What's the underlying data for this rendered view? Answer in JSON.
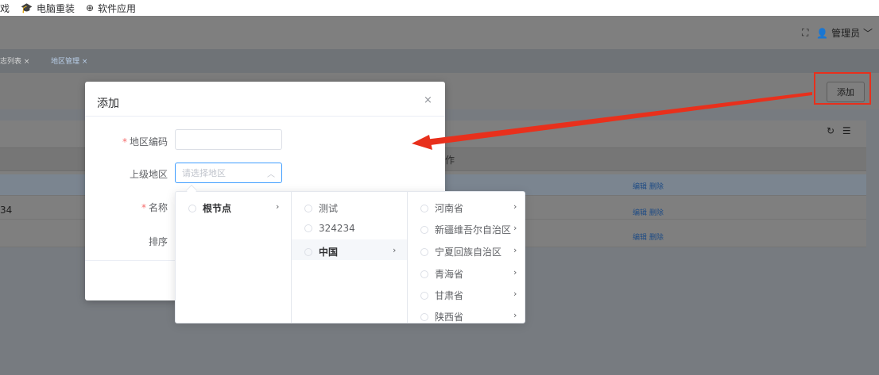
{
  "bookmarks": [
    {
      "label": "戏",
      "icon": ""
    },
    {
      "label": "电脑重装",
      "icon": "graduation-cap-icon"
    },
    {
      "label": "软件应用",
      "icon": "globe-icon"
    }
  ],
  "header": {
    "user": "管理员"
  },
  "tabs": [
    {
      "label": "志列表 ×"
    },
    {
      "label": "地区管理 ×"
    }
  ],
  "toolbar": {
    "add_label": "添加"
  },
  "table": {
    "op_header": "作",
    "rows": [
      {
        "cell": "",
        "ops": "编辑 删除"
      },
      {
        "cell": "34",
        "ops": "编辑 删除"
      },
      {
        "cell": "",
        "ops": "编辑 删除"
      }
    ]
  },
  "dialog": {
    "title": "添加",
    "close": "×",
    "fields": {
      "code_label": "地区编码",
      "parent_label": "上级地区",
      "parent_placeholder": "请选择地区",
      "name_label": "名称",
      "order_label": "排序"
    }
  },
  "cascader": {
    "col1": [
      {
        "label": "根节点",
        "has_children": true
      }
    ],
    "col2": [
      {
        "label": "测试",
        "has_children": false
      },
      {
        "label": "324234",
        "has_children": false
      },
      {
        "label": "中国",
        "has_children": true
      }
    ],
    "col3": [
      {
        "label": "河南省"
      },
      {
        "label": "新疆维吾尔自治区"
      },
      {
        "label": "宁夏回族自治区"
      },
      {
        "label": "青海省"
      },
      {
        "label": "甘肃省"
      },
      {
        "label": "陕西省"
      }
    ]
  },
  "colors": {
    "accent": "#409eff",
    "annotation_red": "#e8301c",
    "required": "#f56c6c"
  }
}
